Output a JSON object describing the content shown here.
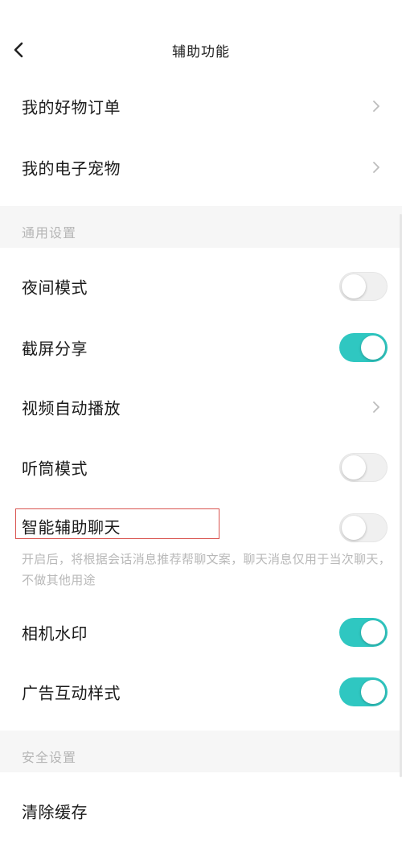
{
  "header": {
    "title": "辅助功能"
  },
  "top_items": [
    {
      "label": "我的好物订单"
    },
    {
      "label": "我的电子宠物"
    }
  ],
  "general_settings": {
    "section_title": "通用设置",
    "items": [
      {
        "label": "夜间模式",
        "control": "toggle",
        "enabled": false
      },
      {
        "label": "截屏分享",
        "control": "toggle",
        "enabled": true
      },
      {
        "label": "视频自动播放",
        "control": "chevron"
      },
      {
        "label": "听筒模式",
        "control": "toggle",
        "enabled": false
      },
      {
        "label": "智能辅助聊天",
        "control": "toggle",
        "enabled": false
      },
      {
        "label": "相机水印",
        "control": "toggle",
        "enabled": true
      },
      {
        "label": "广告互动样式",
        "control": "toggle",
        "enabled": true
      }
    ],
    "smart_chat_hint": "开启后，将根据会话消息推荐帮聊文案，聊天消息仅用于当次聊天，不做其他用途"
  },
  "security_settings": {
    "section_title": "安全设置",
    "items": [
      {
        "label": "清除缓存"
      }
    ]
  },
  "colors": {
    "toggle_on": "#2fc7c1",
    "toggle_off": "#f0f0f0",
    "section_background": "#f6f6f6",
    "highlight_border": "#d9534f"
  },
  "icons": {
    "back": "back-chevron-icon",
    "row_arrow": "chevron-right-icon"
  }
}
